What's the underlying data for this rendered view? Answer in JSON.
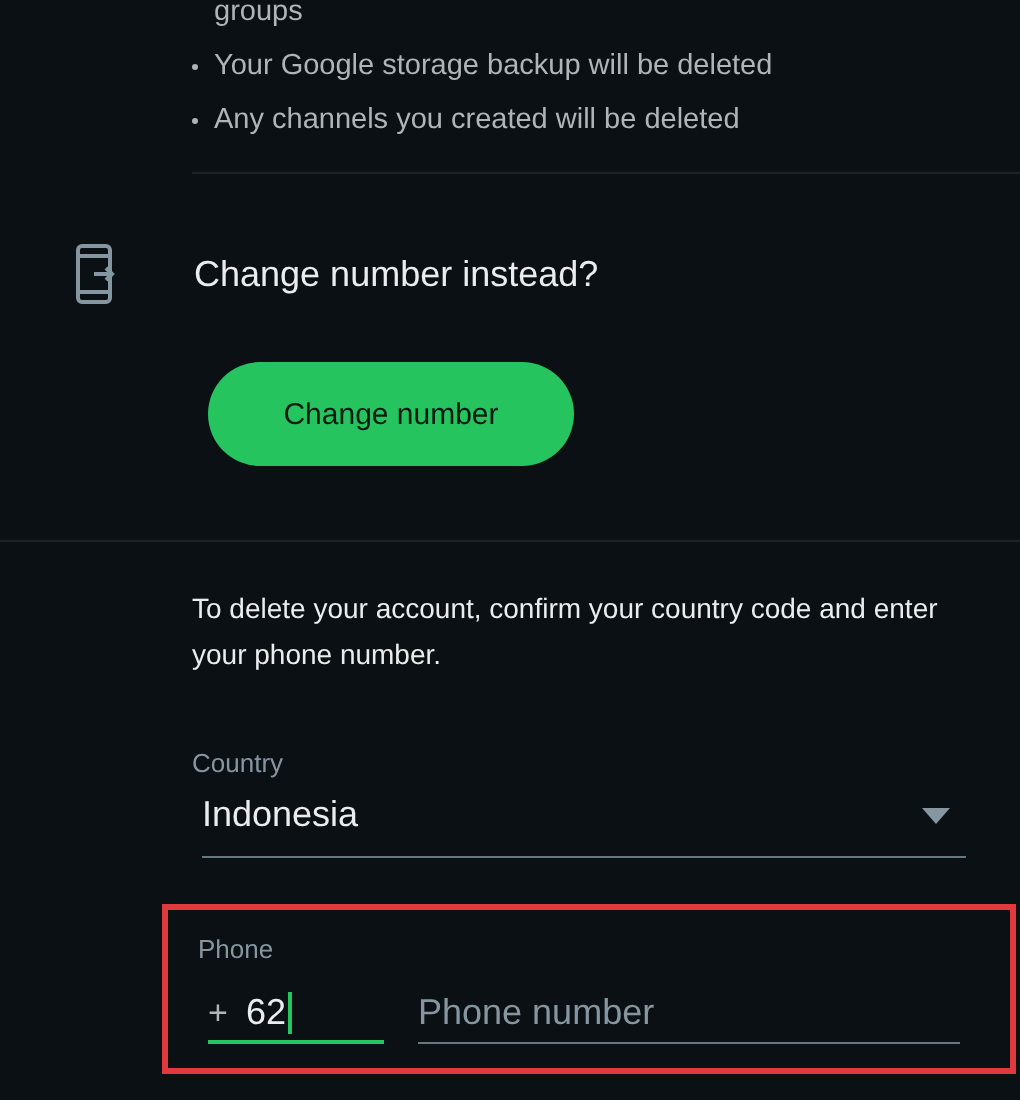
{
  "deletion_effects": [
    {
      "text": "groups",
      "continued": true
    },
    {
      "text": "Your Google storage backup will be deleted",
      "continued": false
    },
    {
      "text": "Any channels you created will be deleted",
      "continued": false
    }
  ],
  "change_number": {
    "heading": "Change number instead?",
    "button": "Change number"
  },
  "delete_form": {
    "instructions": "To delete your account, confirm your country code and enter your phone number.",
    "country": {
      "label": "Country",
      "value": "Indonesia"
    },
    "phone": {
      "label": "Phone",
      "prefix": "+",
      "code": "62",
      "code_focused": true,
      "placeholder": "Phone number",
      "highlighted": true
    }
  }
}
